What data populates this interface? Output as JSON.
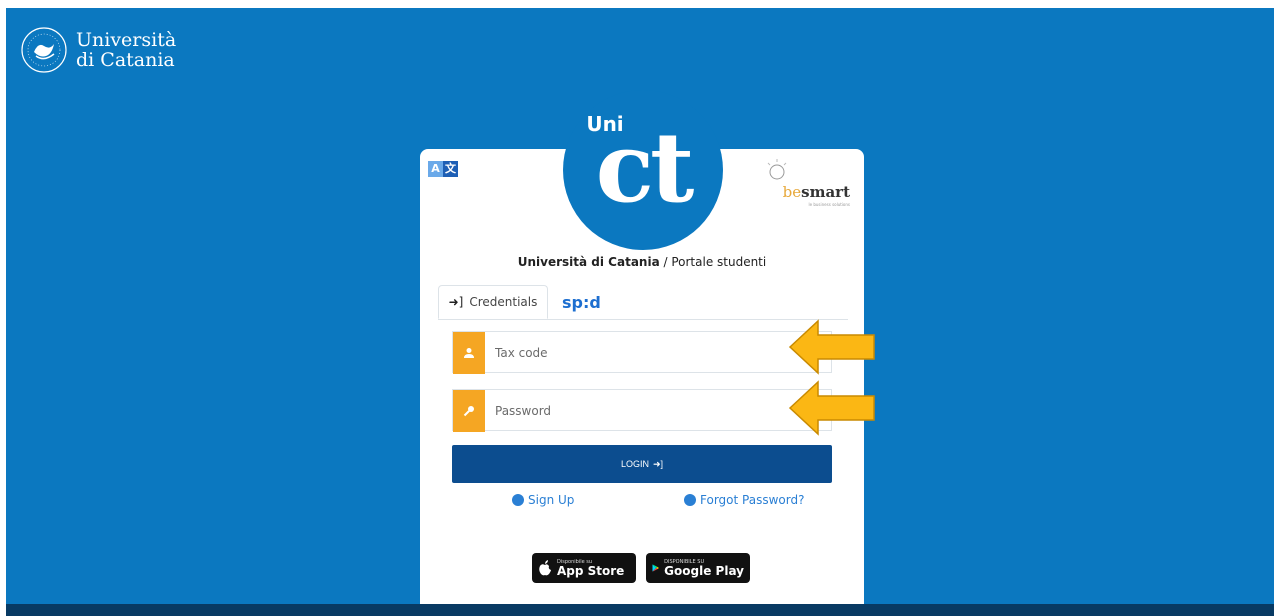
{
  "header": {
    "logo_line1": "Università",
    "logo_line2": "di Catania"
  },
  "card": {
    "circle_logo_top": "Uni",
    "circle_logo_main": "ct",
    "translate_a": "A",
    "translate_b": "文",
    "partner_be": "be",
    "partner_smart": "smart",
    "partner_sub": "le business solutions",
    "title_bold": "Università di Catania",
    "title_rest": " / Portale studenti"
  },
  "tabs": {
    "credentials": "Credentials",
    "spid": "sp:d"
  },
  "form": {
    "tax_placeholder": "Tax code",
    "password_placeholder": "Password",
    "login_label": "LOGIN"
  },
  "links": {
    "signup": "Sign Up",
    "forgot": "Forgot Password?"
  },
  "stores": {
    "apple_small": "Disponibile su",
    "apple_big": "App Store",
    "google_small": "DISPONIBILE SU",
    "google_big": "Google Play"
  },
  "colors": {
    "brand_blue": "#0b78c0",
    "accent_orange": "#f5a623",
    "login_button": "#0c4d8f",
    "arrow_fill": "#fbb714"
  },
  "icons": [
    "university-seal-icon",
    "translate-icon",
    "sign-in-icon",
    "user-icon",
    "key-icon",
    "user-circle-icon",
    "apple-icon",
    "google-play-icon",
    "arrow-left-icon"
  ]
}
